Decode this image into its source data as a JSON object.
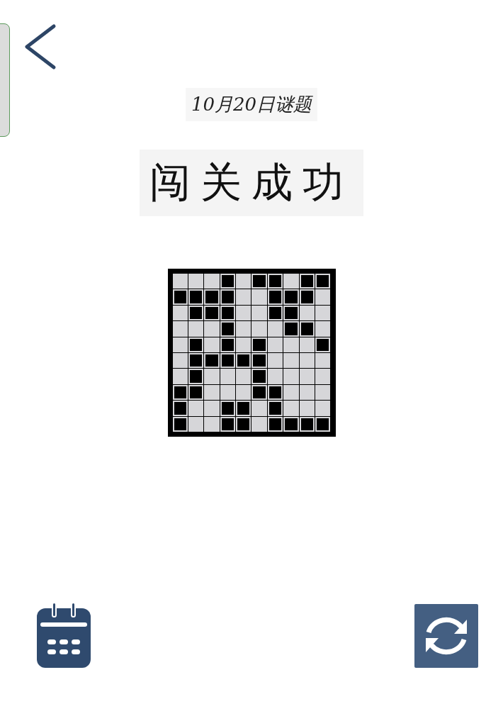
{
  "header": {
    "date_title": "10月20日谜题"
  },
  "result": {
    "title": "闯关成功"
  },
  "grid": {
    "rows": [
      [
        false,
        false,
        false,
        true,
        false,
        true,
        true,
        false,
        true,
        true
      ],
      [
        true,
        true,
        true,
        true,
        false,
        false,
        true,
        true,
        true,
        false
      ],
      [
        false,
        true,
        true,
        true,
        false,
        false,
        true,
        true,
        false,
        false
      ],
      [
        false,
        false,
        false,
        true,
        false,
        false,
        false,
        true,
        true,
        false
      ],
      [
        false,
        true,
        false,
        true,
        false,
        true,
        false,
        false,
        false,
        true
      ],
      [
        false,
        true,
        true,
        true,
        true,
        true,
        false,
        false,
        false,
        false
      ],
      [
        false,
        true,
        false,
        false,
        false,
        true,
        false,
        false,
        false,
        false
      ],
      [
        true,
        true,
        false,
        false,
        false,
        true,
        true,
        false,
        false,
        false
      ],
      [
        true,
        false,
        false,
        true,
        true,
        false,
        true,
        false,
        false,
        false
      ],
      [
        true,
        false,
        false,
        true,
        true,
        false,
        true,
        true,
        true,
        true
      ]
    ]
  }
}
